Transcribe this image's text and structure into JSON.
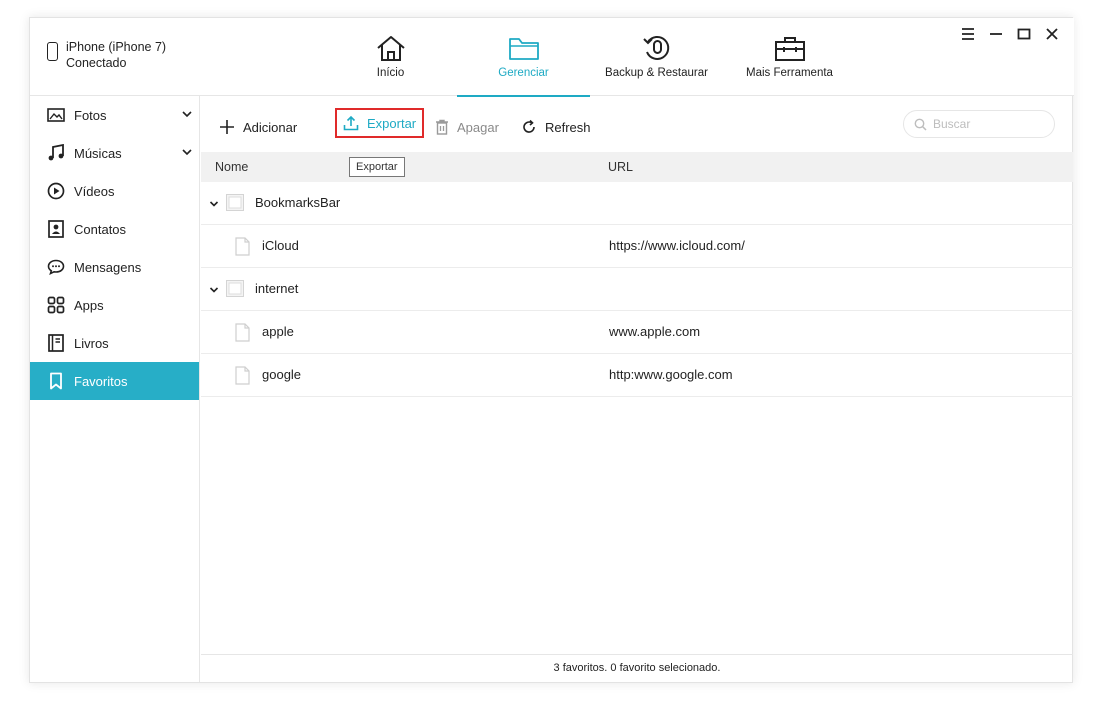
{
  "device": {
    "name": "iPhone (iPhone 7)",
    "status": "Conectado"
  },
  "nav": [
    {
      "label": "Início",
      "icon": "home-icon"
    },
    {
      "label": "Gerenciar",
      "icon": "folder-icon",
      "active": true
    },
    {
      "label": "Backup & Restaurar",
      "icon": "backup-restore-icon"
    },
    {
      "label": "Mais Ferramenta",
      "icon": "toolbox-icon"
    }
  ],
  "sidebar": {
    "items": [
      {
        "label": "Fotos",
        "icon": "photo-icon",
        "expandable": true
      },
      {
        "label": "Músicas",
        "icon": "music-icon",
        "expandable": true
      },
      {
        "label": "Vídeos",
        "icon": "video-icon"
      },
      {
        "label": "Contatos",
        "icon": "contacts-icon"
      },
      {
        "label": "Mensagens",
        "icon": "messages-icon"
      },
      {
        "label": "Apps",
        "icon": "apps-icon"
      },
      {
        "label": "Livros",
        "icon": "book-icon"
      },
      {
        "label": "Favoritos",
        "icon": "bookmark-icon",
        "active": true
      }
    ]
  },
  "toolbar": {
    "add_label": "Adicionar",
    "export_label": "Exportar",
    "delete_label": "Apagar",
    "refresh_label": "Refresh",
    "search_placeholder": "Buscar",
    "tooltip": "Exportar"
  },
  "table": {
    "columns": [
      "Nome",
      "URL"
    ],
    "rows": [
      {
        "type": "folder",
        "name": "BookmarksBar",
        "url": ""
      },
      {
        "type": "bookmark",
        "name": "iCloud",
        "url": "https://www.icloud.com/"
      },
      {
        "type": "folder",
        "name": "internet",
        "url": ""
      },
      {
        "type": "bookmark",
        "name": "apple",
        "url": "www.apple.com"
      },
      {
        "type": "bookmark",
        "name": "google",
        "url": "http:www.google.com"
      }
    ]
  },
  "status": "3 favoritos. 0 favorito selecionado.",
  "colors": {
    "accent": "#1eaac4",
    "sidebar_active": "#27aec7",
    "highlight_border": "#e02a2a"
  }
}
